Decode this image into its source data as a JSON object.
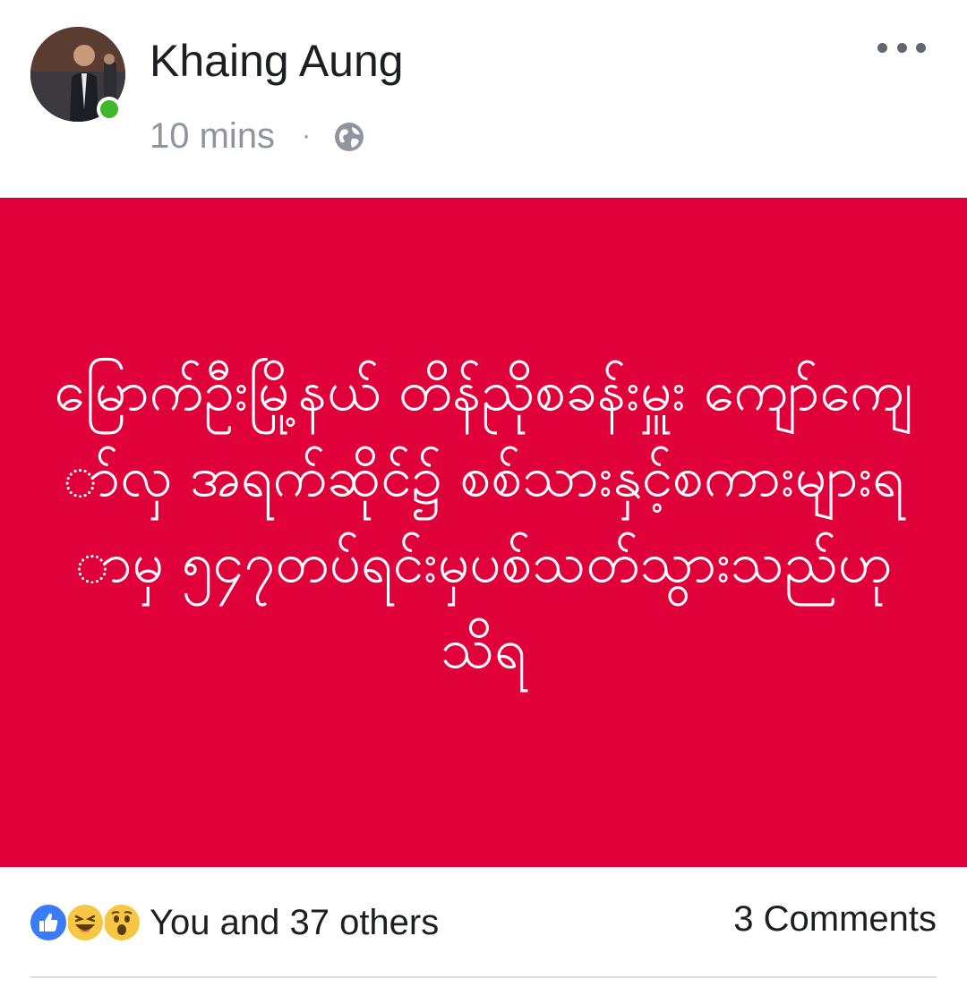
{
  "post": {
    "author": "Khaing Aung",
    "timestamp": "10 mins",
    "separator": "·",
    "audience_icon": "globe-icon",
    "online": true,
    "body_text": "မြောက်ဦးမြို့နယ် တိန်ညိုစခန်းမှူး ကျော်ကျော်လှ အရက်ဆိုင်၌ စစ်သားနှင့်စကားများရာမှ ၅၄၇တပ်ရင်းမှပစ်သတ်သွားသည်ဟုသိရ",
    "background_color": "#e0003a"
  },
  "reactions": {
    "icons": [
      "like-icon",
      "haha-icon",
      "wow-icon"
    ],
    "summary": "You and 37 others"
  },
  "comments": {
    "label": "3 Comments"
  },
  "colors": {
    "online": "#42b72a",
    "like": "#3b7bf5",
    "meta_text": "#90949c"
  }
}
